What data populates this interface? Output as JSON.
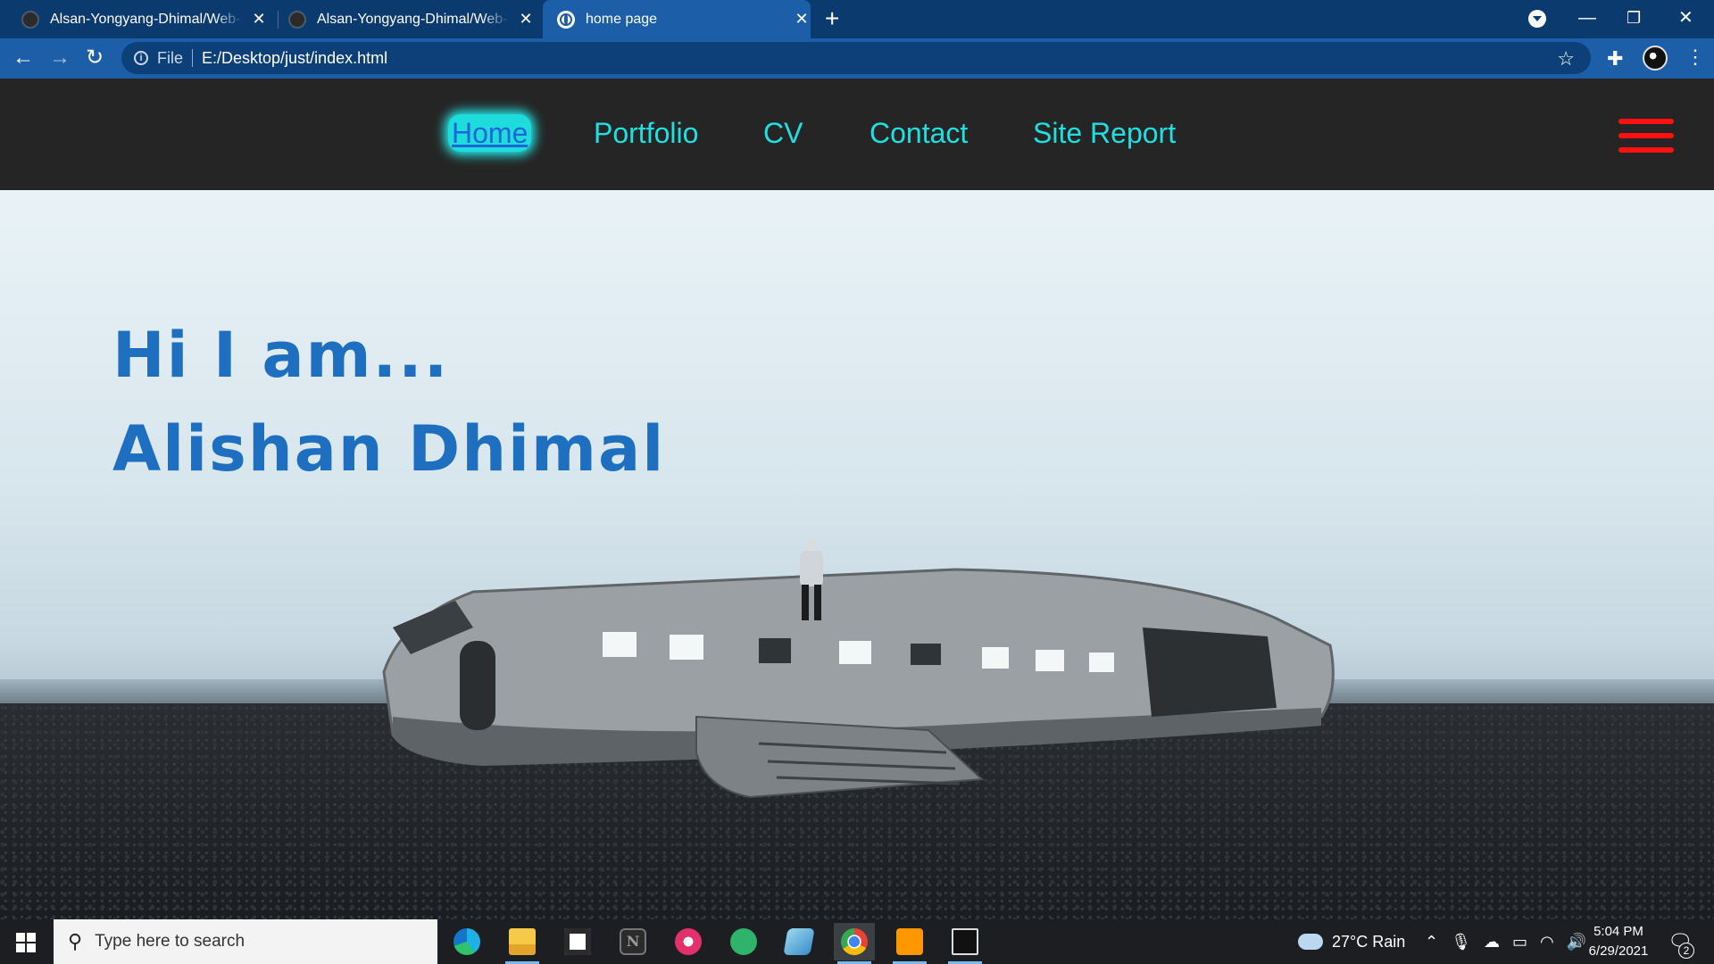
{
  "browser": {
    "tabs": [
      {
        "title": "Alsan-Yongyang-Dhimal/Web-De",
        "icon": "github-icon",
        "active": false
      },
      {
        "title": "Alsan-Yongyang-Dhimal/Web-De",
        "icon": "github-icon",
        "active": false
      },
      {
        "title": "home page",
        "icon": "globe-icon",
        "active": true
      }
    ],
    "new_tab_icon": "+",
    "address": {
      "scheme": "File",
      "url": "E:/Desktop/just/index.html"
    }
  },
  "site": {
    "nav": {
      "home": "Home",
      "portfolio": "Portfolio",
      "cv": "CV",
      "contact": "Contact",
      "report": "Site Report"
    },
    "hero": {
      "line1": "Hi I am...",
      "line2": "Alishan Dhimal"
    },
    "colors": {
      "nav_bg": "#252525",
      "nav_link": "#1fe0e0",
      "hero_text": "#1e6fbf",
      "hamburger": "#ff1010"
    }
  },
  "taskbar": {
    "search_placeholder": "Type here to search",
    "apps": [
      "edge-icon",
      "file-explorer-icon",
      "store-icon",
      "notion-icon",
      "instagram-icon",
      "atom-icon",
      "notepad-icon",
      "chrome-icon",
      "sublime-icon",
      "terminal-icon"
    ],
    "weather": "27°C  Rain",
    "time": "5:04 PM",
    "date": "6/29/2021",
    "notification_count": "2"
  }
}
